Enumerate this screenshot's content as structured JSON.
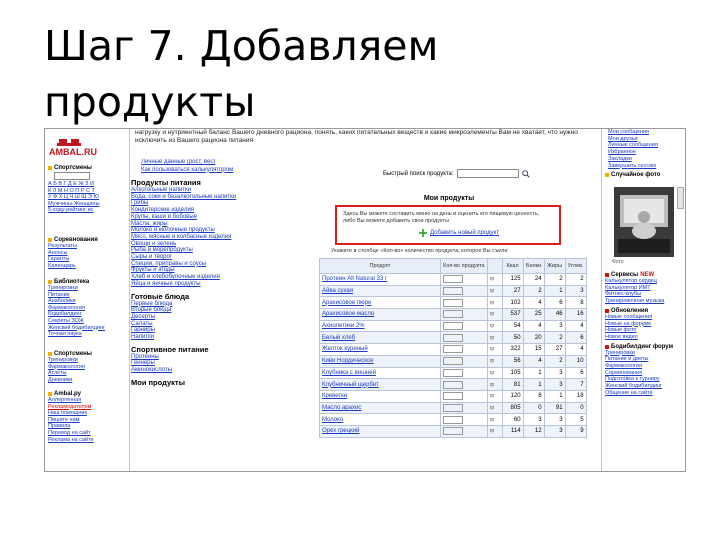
{
  "slide": {
    "title_line1": "Шаг 7. Добавляем",
    "title_line2": "продукты"
  },
  "top_text": "нагрузку и нутриентный баланс Вашего дневного рациона, понять, каких питательных веществ и какие микроэлементы Вам не хватает, что нужно исключить из Вашего рациона питания",
  "left": {
    "logo_text": "AMBAL.RU",
    "sections": [
      {
        "title": "Спортсмены",
        "links": [
          "Мужчины-Женщины",
          "5-ходу-рейтинг ис"
        ]
      },
      {
        "title": "Соревнования",
        "links": [
          "Результаты",
          "Анонсы",
          "Гаранты",
          "Календарь"
        ]
      },
      {
        "title": "Библиотека",
        "links": [
          "Тренировки",
          "Питание",
          "Анаболики",
          "Фармакология",
          "Бодибилдинг",
          "Секреты ЗОЖ",
          "Женский бодибилдинг",
          "Точная наука"
        ]
      },
      {
        "title": "Спортсмены",
        "links": [
          "Тренировки",
          "Фармакология",
          "Атлеты",
          "Дневники"
        ]
      },
      {
        "title": "Ambal.ру",
        "links": [
          "Аллергенная",
          "Рекламодателям",
          "Наш помощник",
          "Пишите нам",
          "Правила",
          "Перевод на сайт",
          "Реклама на сайте"
        ]
      }
    ],
    "alphabet_1": "А Б В Г Д Е Ж З И",
    "alphabet_2": "К Л М Н О П Р С Т",
    "alphabet_3": "У Ф Х Ц Ч Ш Щ Э Ю"
  },
  "middle": {
    "top_links": [
      "Личные данные (рост, вес)",
      "Как пользоваться калькулятором"
    ],
    "products_heading": "Продукты питания",
    "products": [
      "Алкогольные напитки",
      "Вода, соки и безалкогольные напитки",
      "Грибы",
      "Кондитерские изделия",
      "Крупы, каши и бобовые",
      "Масла, жиры",
      "Молоко и молочные продукты",
      "Мясо, мясные и колбасные изделия",
      "Овощи и зелень",
      "Рыба и морепродукты",
      "Сыры и творог",
      "Специи, приправы и соусы",
      "Фрукты и ягоды",
      "Хлеб и хлебобулочные изделия",
      "Яйца и яичные продукты"
    ],
    "dishes_heading": "Готовые блюда",
    "dishes": [
      "Первые блюда",
      "Вторые блюда",
      "Десерты",
      "Салаты",
      "Гарниры",
      "Напитки"
    ],
    "sport_heading": "Спортивное питание",
    "sport": [
      "Протеины",
      "Гейнеры",
      "Аминокислоты"
    ],
    "my_products_heading": "Мои продукты"
  },
  "content": {
    "search_label": "Быстрый поиск продукта:",
    "my_products_title": "Мои продукты",
    "redbox_line1": "Здесь Вы можете составить меню на день и оценить его пищевую ценность,",
    "redbox_line2": "либо Вы можете добавить свои продукты",
    "add_link": "Добавить новый продукт",
    "hint": "Укажите в столбце «Кол-во» количество продукта, которое Вы съели",
    "table": {
      "headers": [
        "Продукт",
        "Кол-во продукта",
        "",
        "Ккал",
        "Белки",
        "Жиры",
        "Углев."
      ],
      "rows": [
        {
          "name": "Протеин All Natural 33 г",
          "unit": "гр",
          "kcal": "125",
          "p": "24",
          "f": "2",
          "c": "2"
        },
        {
          "name": "Айва сухая",
          "unit": "гр",
          "kcal": "27",
          "p": "2",
          "f": "1",
          "c": "3"
        },
        {
          "name": "Арахисовое пюре",
          "unit": "гр",
          "kcal": "102",
          "p": "4",
          "f": "6",
          "c": "8"
        },
        {
          "name": "Арахисовое масло",
          "unit": "гр",
          "kcal": "537",
          "p": "25",
          "f": "46",
          "c": "16"
        },
        {
          "name": "Ахиолетики 2%",
          "unit": "гр",
          "kcal": "54",
          "p": "4",
          "f": "3",
          "c": "4"
        },
        {
          "name": "Белый хлеб",
          "unit": "гр",
          "kcal": "50",
          "p": "20",
          "f": "2",
          "c": "6"
        },
        {
          "name": "Желток куриный",
          "unit": "гр",
          "kcal": "322",
          "p": "15",
          "f": "27",
          "c": "4"
        },
        {
          "name": "Киви Нордическое",
          "unit": "гр",
          "kcal": "56",
          "p": "4",
          "f": "2",
          "c": "10"
        },
        {
          "name": "Клубника с вишней",
          "unit": "гр",
          "kcal": "105",
          "p": "1",
          "f": "3",
          "c": "6"
        },
        {
          "name": "Клубничный щербет",
          "unit": "гр",
          "kcal": "81",
          "p": "1",
          "f": "3",
          "c": "7"
        },
        {
          "name": "Креветки",
          "unit": "гр",
          "kcal": "120",
          "p": "8",
          "f": "1",
          "c": "18"
        },
        {
          "name": "Масло арахис",
          "unit": "гр",
          "kcal": "805",
          "p": "0",
          "f": "91",
          "c": "0"
        },
        {
          "name": "Молоко",
          "unit": "гр",
          "kcal": "60",
          "p": "3",
          "f": "3",
          "c": "5"
        },
        {
          "name": "Орех грецкий",
          "unit": "гр",
          "kcal": "114",
          "p": "12",
          "f": "3",
          "c": "9"
        }
      ]
    }
  },
  "right": {
    "top_links": [
      "Мои сообщения",
      "Мои друзья",
      "Личные сообщения",
      "Избранное",
      "Закладки",
      "Завершить сессию"
    ],
    "random_photo_title": "Случайное фото",
    "photo_caption": "Фото",
    "sections": [
      {
        "title": "Сервисы",
        "badge": "NEW",
        "links": [
          "Калькулятор сердец",
          "Калькулятор ИМТ",
          "Фитнес-клубы",
          "Тренировочная музыка"
        ]
      },
      {
        "title": "Обновления",
        "links": [
          "Новые сообщения",
          "Новые на форуме",
          "Новые фото",
          "Новое видео"
        ]
      },
      {
        "title": "Бодибилдинг форум",
        "links": [
          "Тренировки",
          "Питание и диеты",
          "Фармакология",
          "Соревнования",
          "Подготовка к турниру",
          "Женский бодибилдинг",
          "Общение на сайте"
        ]
      }
    ]
  },
  "colors": {
    "accent_red": "#d62020",
    "link_blue": "#1a3cc0",
    "bullet_yellow": "#f0b000",
    "logo_red": "#c2151f"
  }
}
